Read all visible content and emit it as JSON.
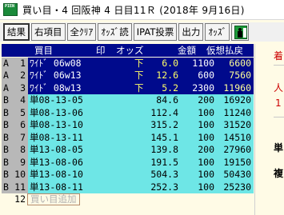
{
  "window": {
    "icon_text": "PIEN",
    "title": "買い目・4 回阪神 4 日目11Ｒ (2018年 9月16日)"
  },
  "toolbar": {
    "buttons": [
      "結果",
      "右項目",
      "全ｸﾘｱ",
      "ｵｯｽﾞ読",
      "IPAT投票",
      "出力",
      "ｵｯｽﾞ"
    ],
    "icon": "exit-door-icon"
  },
  "grid": {
    "headers": {
      "item": "買目",
      "mark": "印",
      "odds": "オッズ",
      "amount": "金額",
      "payout": "仮想払戻"
    },
    "rows": [
      {
        "group": "A",
        "no": "1",
        "item": "ﾜｲﾄﾞ 06w08",
        "mark": "下",
        "odds": "6.0",
        "amount": "1100",
        "payout": "6600"
      },
      {
        "group": "A",
        "no": "2",
        "item": "ﾜｲﾄﾞ 06w13",
        "mark": "下",
        "odds": "12.6",
        "amount": "600",
        "payout": "7560"
      },
      {
        "group": "A",
        "no": "3",
        "item": "ﾜｲﾄﾞ 08w13",
        "mark": "下",
        "odds": "5.2",
        "amount": "2300",
        "payout": "11960"
      },
      {
        "group": "B",
        "no": "4",
        "item": "単08-13-05",
        "mark": "",
        "odds": "84.6",
        "amount": "200",
        "payout": "16920"
      },
      {
        "group": "B",
        "no": "5",
        "item": "単08-13-06",
        "mark": "",
        "odds": "112.4",
        "amount": "100",
        "payout": "11240"
      },
      {
        "group": "B",
        "no": "6",
        "item": "単08-13-10",
        "mark": "",
        "odds": "315.2",
        "amount": "100",
        "payout": "31520"
      },
      {
        "group": "B",
        "no": "7",
        "item": "単08-13-11",
        "mark": "",
        "odds": "145.1",
        "amount": "100",
        "payout": "14510"
      },
      {
        "group": "B",
        "no": "8",
        "item": "単13-08-05",
        "mark": "",
        "odds": "139.8",
        "amount": "200",
        "payout": "27960"
      },
      {
        "group": "B",
        "no": "9",
        "item": "単13-08-06",
        "mark": "",
        "odds": "191.5",
        "amount": "100",
        "payout": "19150"
      },
      {
        "group": "B",
        "no": "10",
        "item": "単13-08-10",
        "mark": "",
        "odds": "504.3",
        "amount": "100",
        "payout": "50430"
      },
      {
        "group": "B",
        "no": "11",
        "item": "単13-08-11",
        "mark": "",
        "odds": "252.3",
        "amount": "100",
        "payout": "25230"
      }
    ],
    "add_row": {
      "no": "12",
      "label": "買い目追加"
    }
  },
  "side": {
    "label1": "着",
    "label2": "人",
    "label3": "1",
    "label4": "単",
    "label5": "複"
  }
}
